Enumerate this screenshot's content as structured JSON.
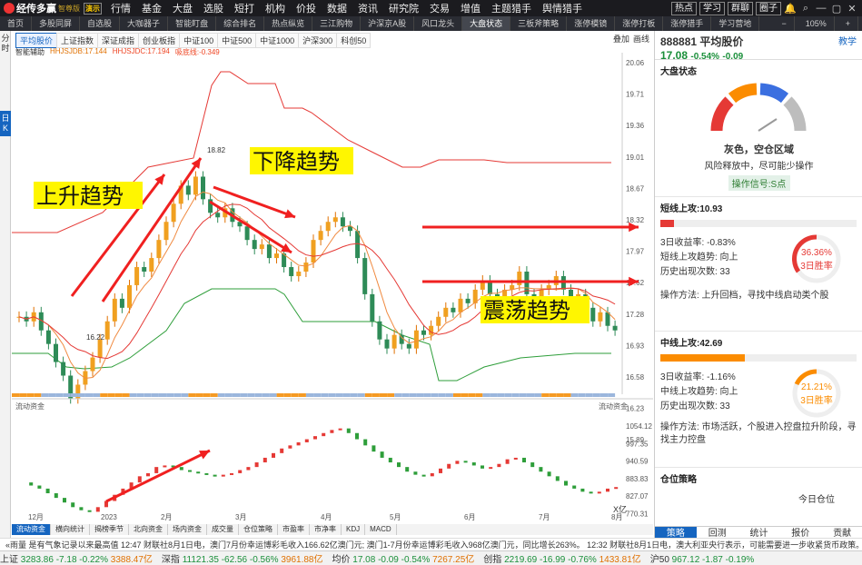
{
  "app": {
    "name": "经传多赢",
    "edition": "智尊版",
    "demo": "演示"
  },
  "menu": [
    "行情",
    "基金",
    "大盘",
    "选股",
    "短打",
    "机构",
    "价投",
    "数据",
    "资讯",
    "研究院",
    "交易",
    "增值",
    "主题猎手",
    "舆情猎手"
  ],
  "top_right": [
    "热点",
    "学习",
    "群聊",
    "圈子"
  ],
  "zoom": "105%",
  "tabs": [
    "首页",
    "多股同屏",
    "自选股",
    "大咖器子",
    "智能盯盘",
    "综合排名",
    "热点纵览",
    "三江购物",
    "沪深京A股",
    "风口龙头",
    "大盘状态",
    "三板斧策略",
    "涨停模镜",
    "涨停打板",
    "涨停猎手",
    "学习营地"
  ],
  "active_tab": "大盘状态",
  "left_tabs": [
    "分时",
    "日K"
  ],
  "chart_tabs": [
    "平均股价",
    "上证指数",
    "深证成指",
    "创业板指",
    "中证100",
    "中证500",
    "中证1000",
    "沪深300",
    "科创50"
  ],
  "chart_right": [
    "叠加",
    "画线"
  ],
  "legend": {
    "title": "智能辅助",
    "a": "HHJSJDB:17.144",
    "b": "HHJSJDC:17.194",
    "c": "吸底线:-0.349"
  },
  "price_axis": [
    "20.06",
    "19.71",
    "19.36",
    "19.01",
    "18.67",
    "18.32",
    "17.97",
    "17.62",
    "17.28",
    "16.93",
    "16.58",
    "16.23",
    "15.89"
  ],
  "price_marks": {
    "high": "18.82",
    "low": "16.22"
  },
  "annotations": {
    "up": "上升趋势",
    "down": "下降趋势",
    "range": "震荡趋势"
  },
  "flow_label": "流动资金",
  "flow_axis": [
    "1054.12",
    "997.35",
    "940.59",
    "883.83",
    "827.07",
    "770.31"
  ],
  "flow_unit": "X亿",
  "months": [
    "12月",
    "2023",
    "2月",
    "3月",
    "4月",
    "5月",
    "6月",
    "7月",
    "8月"
  ],
  "bottom_tabs": [
    "流动资金",
    "横向统计",
    "揭榜季节",
    "北向资金",
    "场内资金",
    "成交量",
    "仓位策略",
    "市盈率",
    "市净率",
    "KDJ",
    "MACD"
  ],
  "panel": {
    "code": "888881",
    "name": "平均股价",
    "link": "教学",
    "price": "17.08",
    "chg": "-0.54%",
    "chg_abs": "-0.09",
    "state_title": "大盘状态",
    "state": "灰色，空仓区域",
    "state_desc": "风险释放中，尽可能少操作",
    "signal": "操作信号:S点",
    "short_title": "短线上攻:10.93",
    "short_rows": [
      "3日收益率: -0.83%",
      "短线上攻趋势: 向上",
      "历史出现次数: 33"
    ],
    "short_pct": "36.36%",
    "short_win": "3日胜率",
    "short_method": "操作方法: 上升回档，寻找中线启动类个股",
    "mid_title": "中线上攻:42.69",
    "mid_rows": [
      "3日收益率: -1.16%",
      "中线上攻趋势: 向上",
      "历史出现次数: 33"
    ],
    "mid_pct": "21.21%",
    "mid_win": "3日胜率",
    "mid_method": "操作方法: 市场活跃，个股进入控盘拉升阶段，寻找主力控盘",
    "pos_title": "仓位策略",
    "today": "今日仓位",
    "tabs": [
      "策略",
      "回测",
      "统计",
      "报价",
      "贡献"
    ]
  },
  "ticker": "«雨量 是有气象记录以来最高值    12:47 财联社8月1日电，澳门7月份幸运博彩毛收入166.62亿澳门元; 澳门1-7月份幸运博彩毛收入968亿澳门元，同比增长263%。    12:32 财联社8月1日电，澳大利亚央行表示，可能需要进一步收紧货币政策。",
  "status": [
    {
      "name": "上证",
      "val": "3283.86",
      "chg": "-7.18",
      "pct": "-0.22%",
      "amt": "3388.47亿"
    },
    {
      "name": "深指",
      "val": "11121.35",
      "chg": "-62.56",
      "pct": "-0.56%",
      "amt": "3961.88亿"
    },
    {
      "name": "均价",
      "val": "17.08",
      "chg": "-0.09",
      "pct": "-0.54%",
      "amt": "7267.25亿"
    },
    {
      "name": "创指",
      "val": "2219.69",
      "chg": "-16.99",
      "pct": "-0.76%",
      "amt": "1433.81亿"
    },
    {
      "name": "沪50",
      "val": "967.12",
      "chg": "-1.87",
      "pct": "-0.19%",
      "amt": ""
    }
  ]
}
